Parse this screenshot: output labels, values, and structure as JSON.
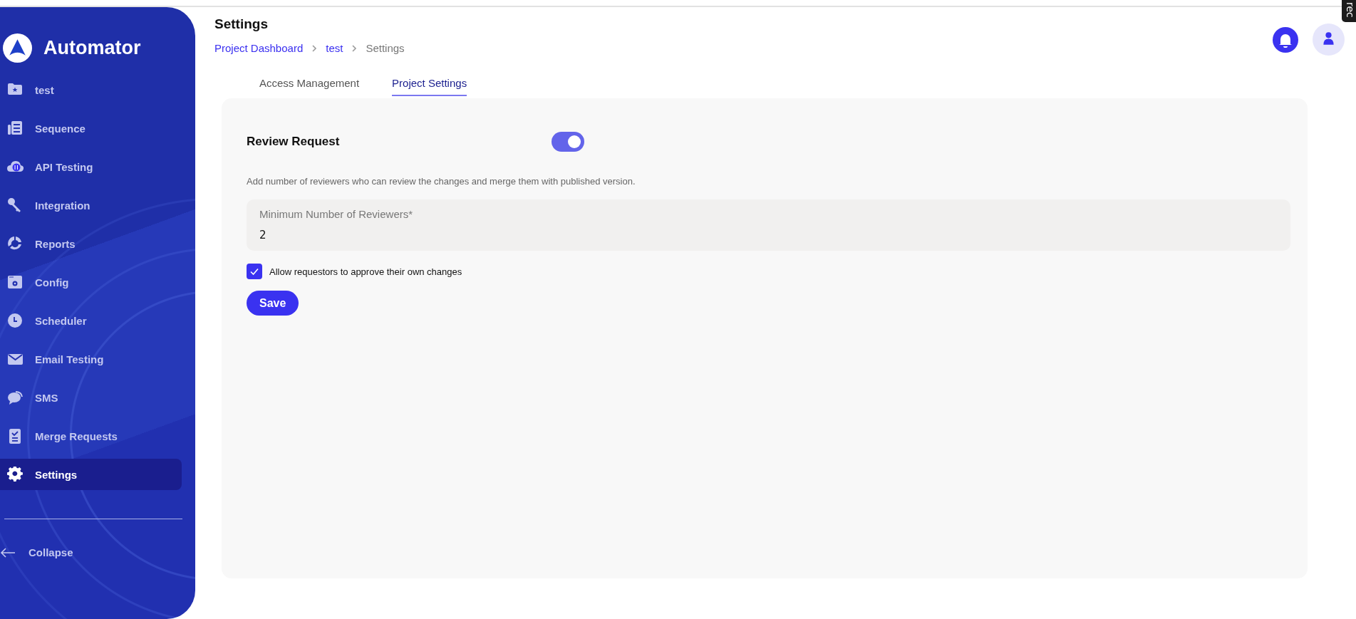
{
  "sidebar": {
    "app_name": "Automator",
    "items": [
      {
        "label": "test",
        "kind": "folder",
        "selected": false
      },
      {
        "label": "Sequence",
        "kind": "sequence",
        "selected": false
      },
      {
        "label": "API Testing",
        "kind": "cloud",
        "selected": false
      },
      {
        "label": "Integration",
        "kind": "key",
        "selected": false
      },
      {
        "label": "Reports",
        "kind": "reports",
        "selected": false
      },
      {
        "label": "Config",
        "kind": "config",
        "selected": false
      },
      {
        "label": "Scheduler",
        "kind": "clock",
        "selected": false
      },
      {
        "label": "Email Testing",
        "kind": "mail",
        "selected": false
      },
      {
        "label": "SMS",
        "kind": "chat",
        "selected": false
      },
      {
        "label": "Merge Requests",
        "kind": "clipboard",
        "selected": false
      },
      {
        "label": "Settings",
        "kind": "gear",
        "selected": true
      }
    ],
    "collapse": "Collapse"
  },
  "header": {
    "title": "Settings",
    "breadcrumb": [
      {
        "label": "Project Dashboard",
        "kind": "link"
      },
      {
        "label": "test",
        "kind": "link"
      },
      {
        "label": "Settings",
        "kind": "current"
      }
    ]
  },
  "tabs": [
    {
      "label": "Access Management",
      "selected": false
    },
    {
      "label": "Project Settings",
      "selected": true
    }
  ],
  "review_request": {
    "title": "Review Request",
    "on": true,
    "description": "Add number of reviewers who can review the changes and merge them with published version.",
    "field": {
      "label": "Minimum Number of Reviewers*",
      "value": "2"
    },
    "checkbox": {
      "label": "Allow requestors to approve their own changes",
      "checked": true
    },
    "save": "Save"
  },
  "recorder_tab": "rec"
}
